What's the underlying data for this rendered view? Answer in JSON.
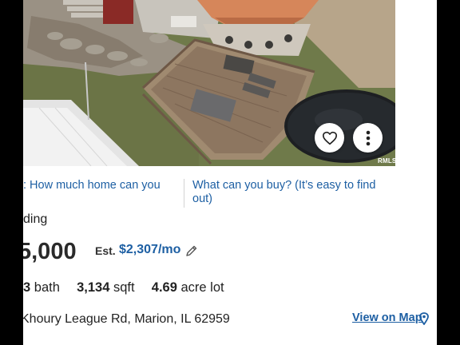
{
  "listing": {
    "watermark": "RMLS",
    "links": {
      "left": ": How much home can you",
      "right": "What can you buy? (It’s easy to find out)"
    },
    "status_partial": "ding",
    "price_partial": "5,000",
    "est_label": "Est.",
    "monthly_payment": "$2,307/mo",
    "facts": {
      "bath_count": "3",
      "bath_label": "bath",
      "sqft_value": "3,134",
      "sqft_label": "sqft",
      "lot_value": "4.69",
      "lot_label": "acre lot"
    },
    "address": "Khoury League Rd, Marion, IL 62959",
    "map_link": "View on Map"
  },
  "icons": {
    "favorite": "heart-outline-icon",
    "more": "vertical-dots-icon",
    "edit": "pencil-icon",
    "map": "map-pin-icon"
  },
  "colors": {
    "link": "#1d5fa3",
    "text": "#222222",
    "background": "#ffffff"
  }
}
